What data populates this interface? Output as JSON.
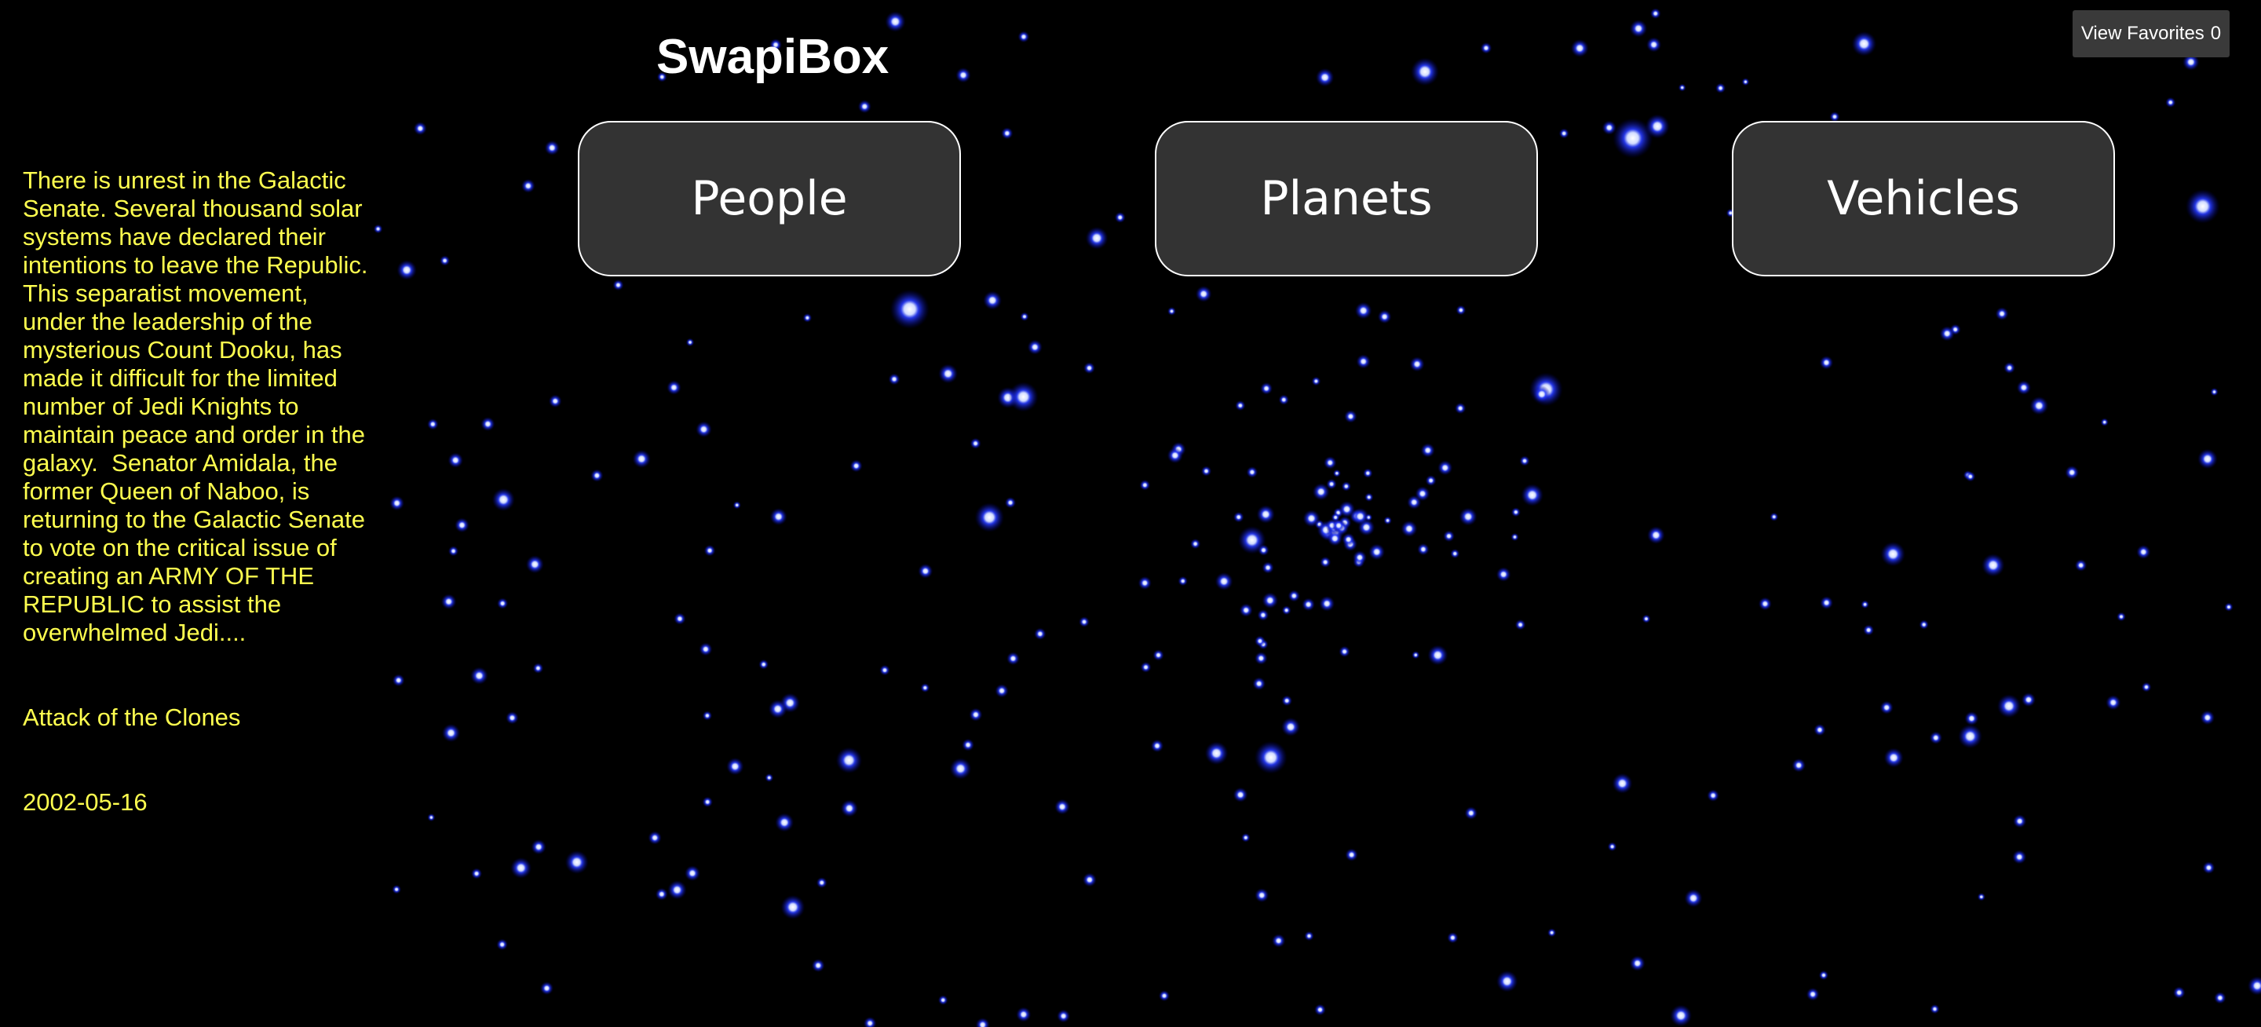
{
  "app": {
    "title": "SwapiBox"
  },
  "favorites_button": {
    "label": "View Favorites",
    "count": "0"
  },
  "categories": [
    {
      "label": "People"
    },
    {
      "label": "Planets"
    },
    {
      "label": "Vehicles"
    }
  ],
  "opening_crawl": {
    "text": "There is unrest in the Galactic Senate. Several thousand solar systems have declared their intentions to leave the Republic.  This separatist movement, under the leadership of the mysterious Count Dooku, has made it difficult for the limited number of Jedi Knights to maintain peace and order in the galaxy.  Senator Amidala, the former Queen of Naboo, is returning to the Galactic Senate to vote on the critical issue of creating an ARMY OF THE REPUBLIC to assist the overwhelmed Jedi....",
    "film_title": "Attack of the Clones",
    "release_date": "2002-05-16"
  },
  "colors": {
    "background": "#000000",
    "crawl_text": "#ffff4f",
    "button_fill": "#333333",
    "button_border": "#ffffff",
    "star_glow": "#1a2cff"
  },
  "background_decoration": "starfield"
}
